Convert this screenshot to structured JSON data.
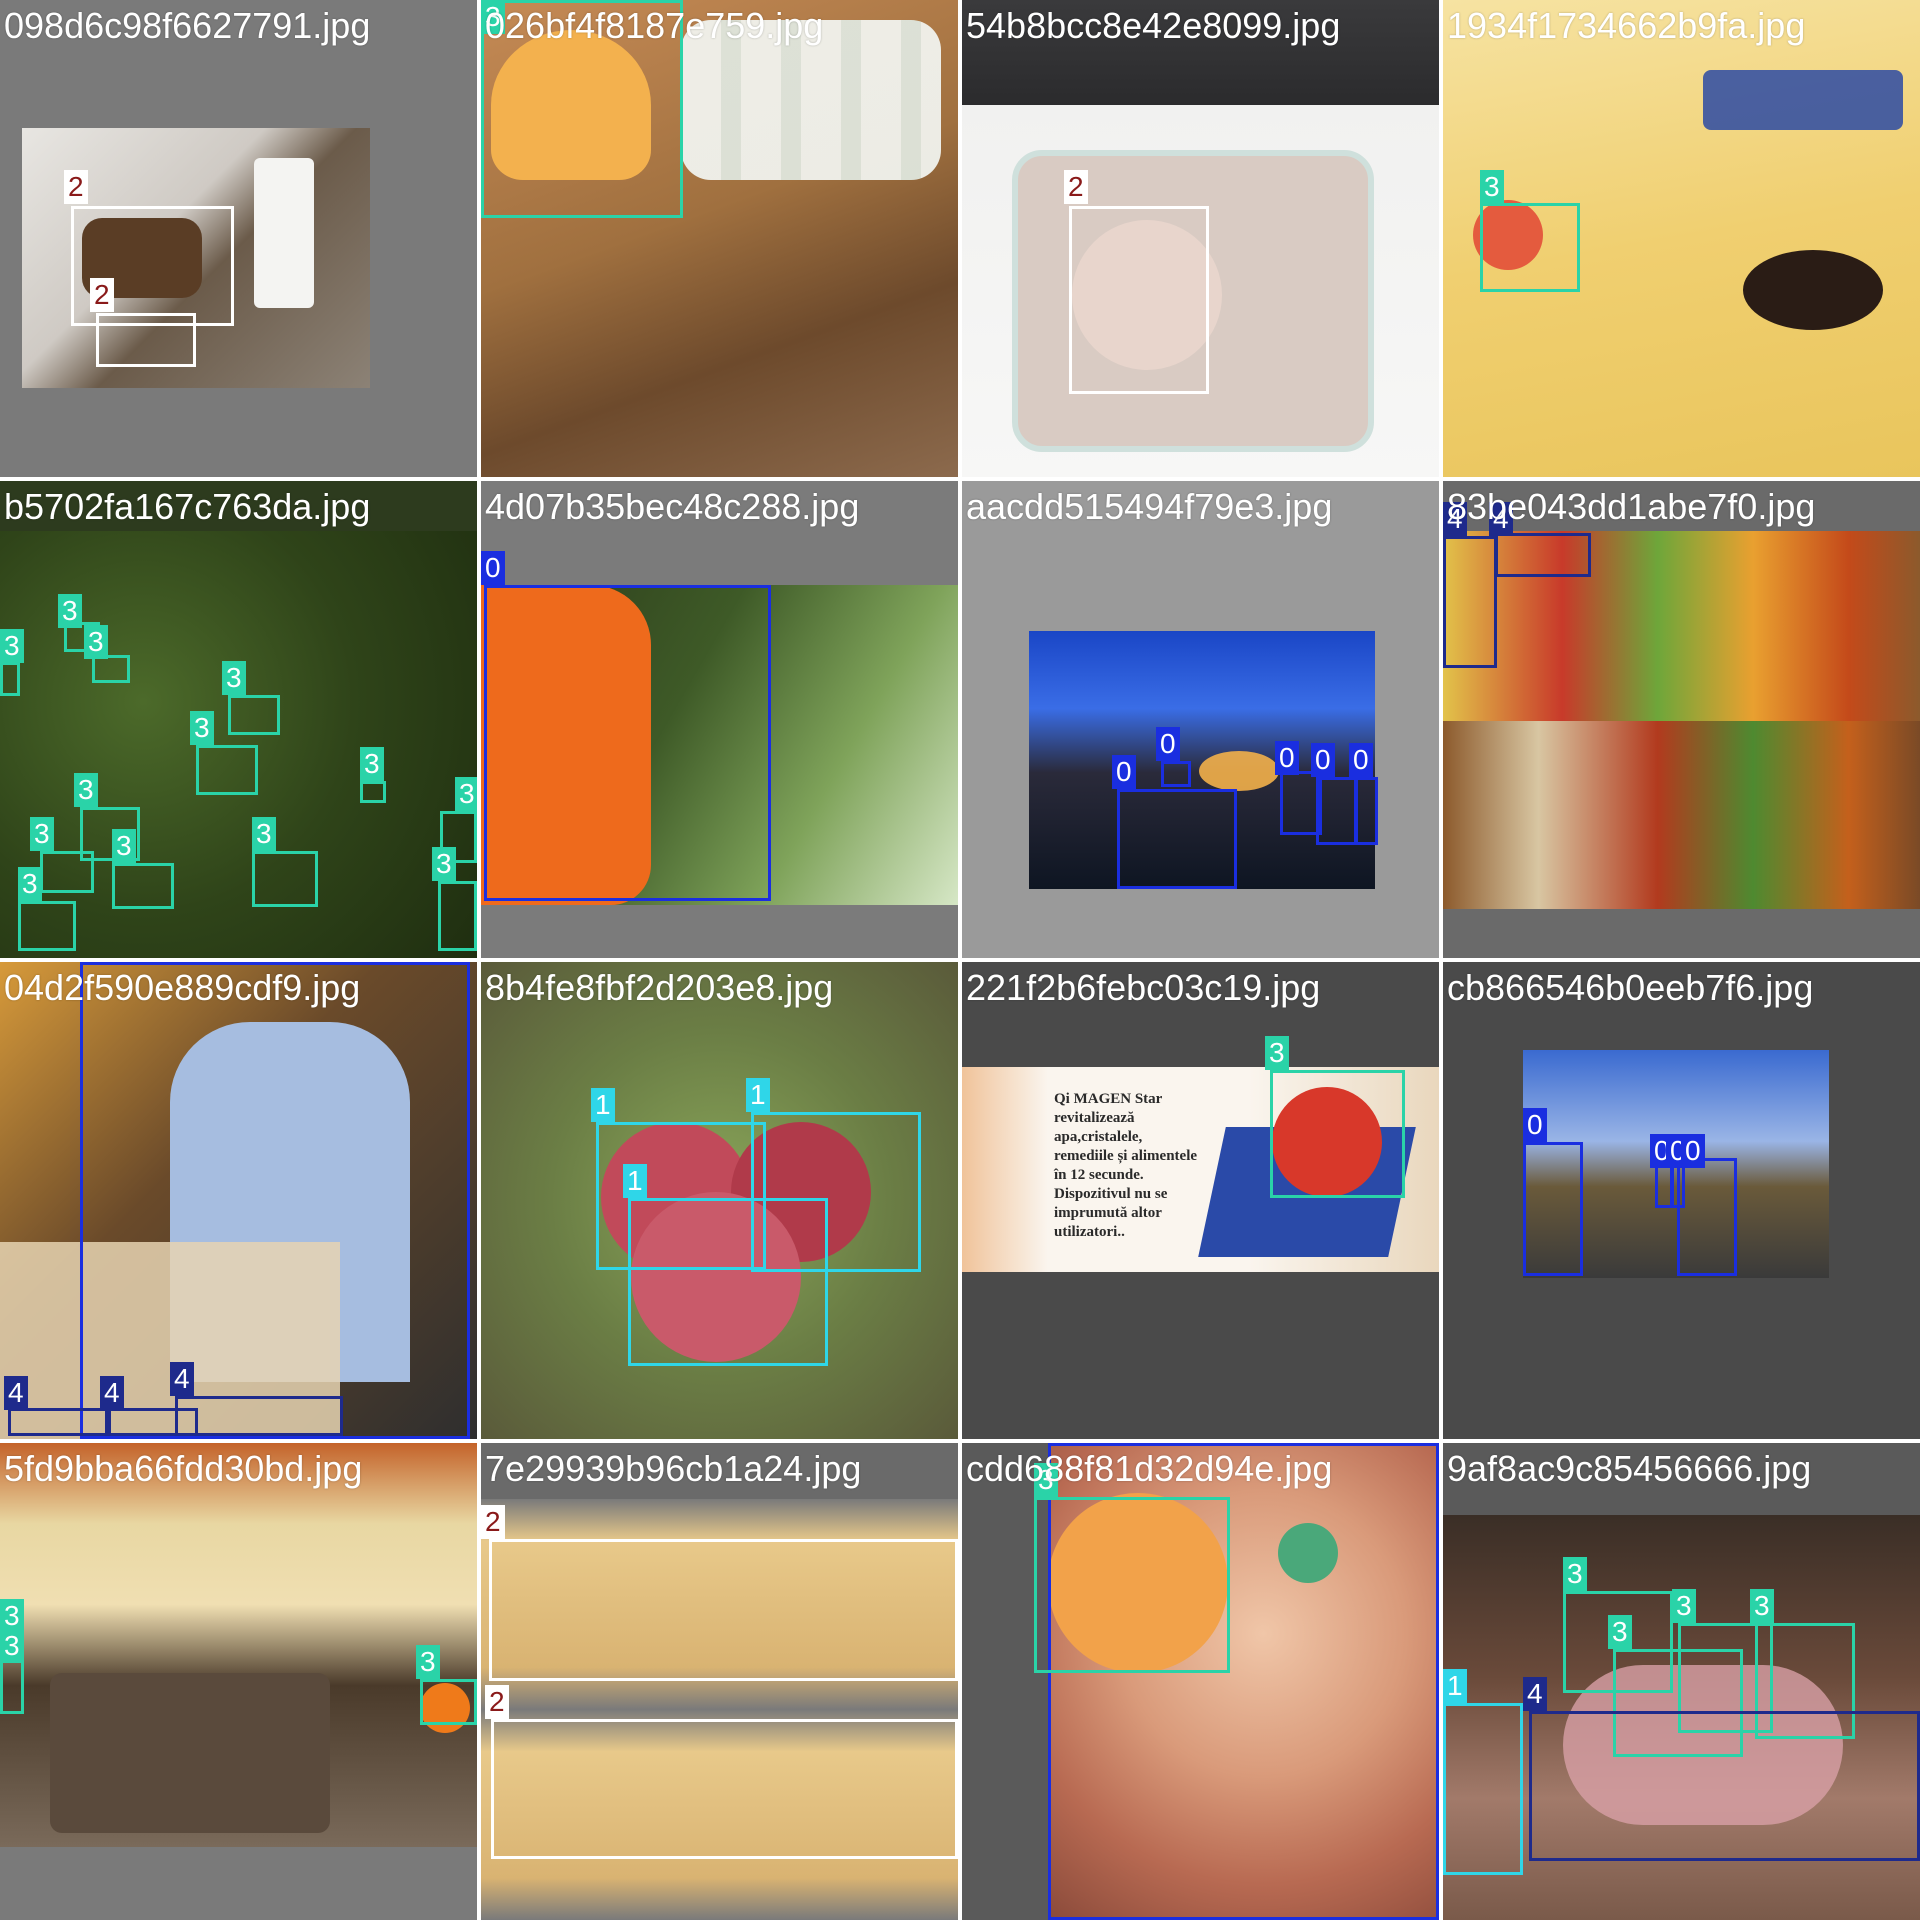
{
  "tiles": [
    {
      "filename": "098d6c98f6627791.jpg",
      "labels": [
        "2",
        "2"
      ]
    },
    {
      "filename": "026bf4f8187e759.jpg",
      "labels": [
        "3"
      ]
    },
    {
      "filename": "54b8bcc8e42e8099.jpg",
      "labels": [
        "2"
      ]
    },
    {
      "filename": "1934f1734662b9fa.jpg",
      "labels": [
        "3"
      ]
    },
    {
      "filename": "b5702fa167c763da.jpg",
      "labels": [
        "3",
        "3",
        "3",
        "3",
        "3",
        "3",
        "3",
        "3",
        "3",
        "3",
        "3",
        "3",
        "3"
      ]
    },
    {
      "filename": "4d07b35bec48c288.jpg",
      "labels": [
        "0"
      ]
    },
    {
      "filename": "aacdd515494f79e3.jpg",
      "labels": [
        "0",
        "0",
        "0",
        "0",
        "0"
      ]
    },
    {
      "filename": "83be043dd1abe7f0.jpg",
      "labels": [
        "4",
        "4"
      ]
    },
    {
      "filename": "04d2f590e889cdf9.jpg",
      "labels": [
        "0",
        "4",
        "4",
        "4"
      ]
    },
    {
      "filename": "8b4fe8fbf2d203e8.jpg",
      "labels": [
        "1",
        "1",
        "1"
      ]
    },
    {
      "filename": "221f2b6febc03c19.jpg",
      "labels": [
        "3"
      ]
    },
    {
      "filename": "cb866546b0eeb7f6.jpg",
      "labels": [
        "0",
        "0",
        "0",
        "0"
      ]
    },
    {
      "filename": "5fd9bba66fdd30bd.jpg",
      "labels": [
        "3",
        "3",
        "3"
      ]
    },
    {
      "filename": "7e29939b96cb1a24.jpg",
      "labels": [
        "2",
        "2"
      ]
    },
    {
      "filename": "cdd688f81d32d94e.jpg",
      "labels": [
        "0",
        "3"
      ]
    },
    {
      "filename": "9af8ac9c85456666.jpg",
      "labels": [
        "1",
        "3",
        "3",
        "3",
        "3",
        "4"
      ]
    }
  ],
  "poster_text": "Qi MAGEN Star revitalizează apa,cristalele, remediile și alimentele în 12 secunde. Dispozitivul nu se imprumută altor utilizatori.."
}
